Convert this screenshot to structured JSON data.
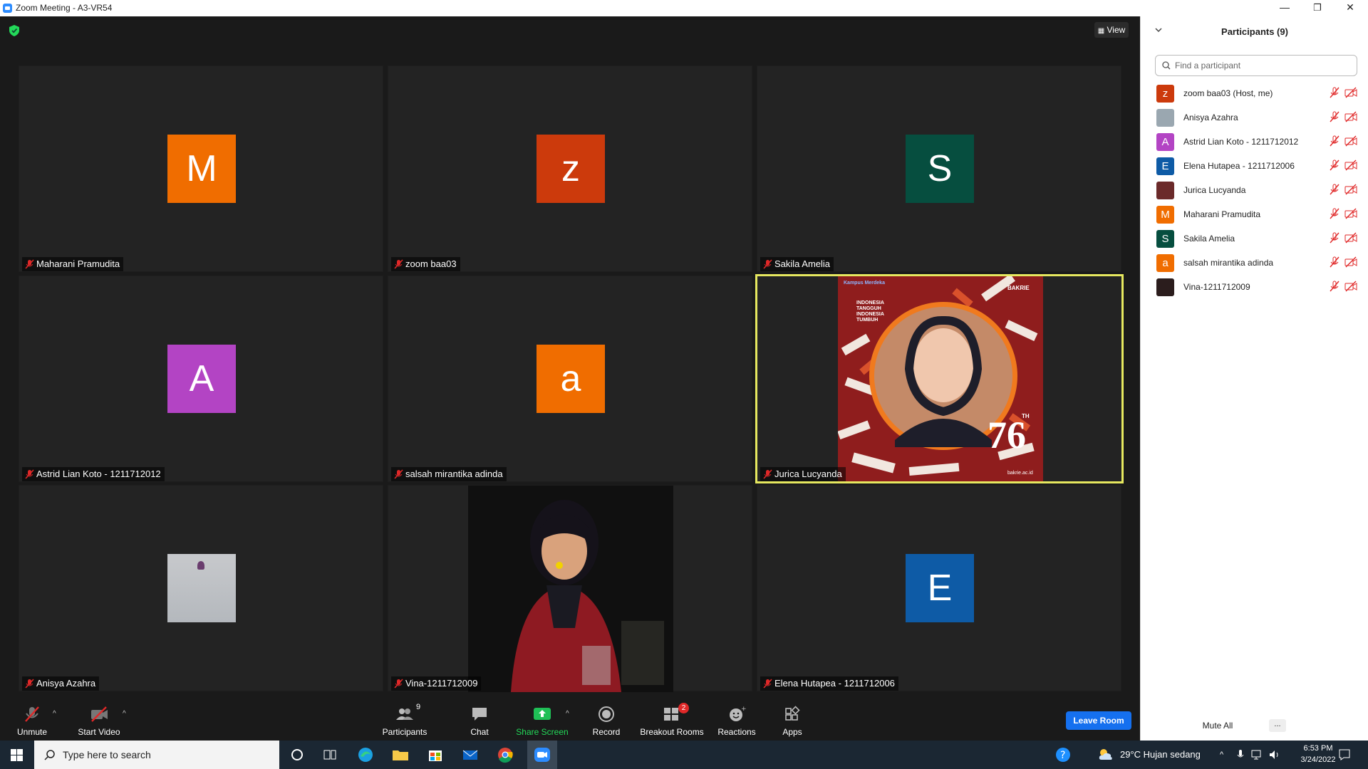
{
  "window": {
    "title": "Zoom Meeting - A3-VR54",
    "min": "—",
    "restore": "❐",
    "close": "✕"
  },
  "view_button": "View",
  "tiles": [
    {
      "name": "Maharani Pramudita",
      "initial": "M",
      "color": "#f06d00"
    },
    {
      "name": "zoom baa03",
      "initial": "z",
      "color": "#cc3a0c"
    },
    {
      "name": "Sakila Amelia",
      "initial": "S",
      "color": "#064e3f"
    },
    {
      "name": "Astrid Lian Koto - 1211712012",
      "initial": "A",
      "color": "#b344c4"
    },
    {
      "name": "salsah mirantika adinda",
      "initial": "a",
      "color": "#f06d00"
    },
    {
      "name": "Jurica Lucyanda",
      "poster": {
        "brand": "BAKRIE",
        "line1": "INDONESIA",
        "line2": "TANGGUH",
        "line3": "INDONESIA",
        "line4": "TUMBUH",
        "number": "76",
        "suffix": "TH",
        "site": "bakrie.ac.id",
        "badge": "Kampus Merdeka"
      }
    },
    {
      "name": "Anisya Azahra"
    },
    {
      "name": "Vina-1211712009"
    },
    {
      "name": "Elena Hutapea - 1211712006",
      "initial": "E",
      "color": "#0e5ba6"
    }
  ],
  "toolbar": {
    "unmute": "Unmute",
    "start_video": "Start Video",
    "participants": "Participants",
    "participants_count": "9",
    "chat": "Chat",
    "share_screen": "Share Screen",
    "record": "Record",
    "breakout_rooms": "Breakout Rooms",
    "breakout_badge": "2",
    "reactions": "Reactions",
    "apps": "Apps",
    "leave": "Leave Room"
  },
  "panel": {
    "title": "Participants (9)",
    "search_placeholder": "Find a participant",
    "participants": [
      {
        "name": "zoom baa03 (Host, me)",
        "initial": "z",
        "color": "#cc3a0c"
      },
      {
        "name": "Anisya Azahra",
        "initial": "",
        "color": "#9aa7b0"
      },
      {
        "name": "Astrid Lian Koto - 1211712012",
        "initial": "A",
        "color": "#b344c4"
      },
      {
        "name": "Elena Hutapea - 1211712006",
        "initial": "E",
        "color": "#0e5ba6"
      },
      {
        "name": "Jurica Lucyanda",
        "initial": "",
        "color": "#6b2a2a"
      },
      {
        "name": "Maharani Pramudita",
        "initial": "M",
        "color": "#f06d00"
      },
      {
        "name": "Sakila Amelia",
        "initial": "S",
        "color": "#064e3f"
      },
      {
        "name": "salsah mirantika adinda",
        "initial": "a",
        "color": "#f06d00"
      },
      {
        "name": "Vina-1211712009",
        "initial": "",
        "color": "#2b1d1d"
      }
    ],
    "mute_all": "Mute All",
    "more": "..."
  },
  "taskbar": {
    "search_placeholder": "Type here to search",
    "weather": "29°C  Hujan sedang",
    "time": "6:53 PM",
    "date": "3/24/2022"
  }
}
